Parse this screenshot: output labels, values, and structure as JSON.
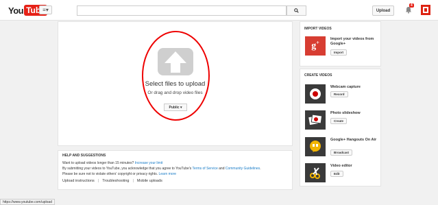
{
  "header": {
    "logo_you": "You",
    "logo_tube": "Tube",
    "guide_label": "≡▾",
    "search_placeholder": "",
    "upload_label": "Upload",
    "notification_count": "4"
  },
  "upload": {
    "title": "Select files to upload",
    "subtitle": "Or drag and drop video files",
    "privacy": "Public ▾"
  },
  "help": {
    "title": "HELP AND SUGGESTIONS",
    "line1_prefix": "Want to upload videos longer than 15 minutes? ",
    "line1_link": "Increase your limit",
    "line2_prefix": "By submitting your videos to YouTube, you acknowledge that you agree to YouTube's ",
    "line2_tos": "Terms of Service",
    "line2_and": " and ",
    "line2_guidelines": "Community Guidelines",
    "line2_end": ".",
    "line3_prefix": "Please be sure not to violate others' copyright or privacy rights. ",
    "line3_link": "Learn more",
    "links": [
      "Upload instructions",
      "Troubleshooting",
      "Mobile uploads"
    ],
    "separator": "|"
  },
  "import": {
    "title": "IMPORT VIDEOS",
    "item_title": "Import your videos from Google+",
    "button": "Import"
  },
  "create": {
    "title": "CREATE VIDEOS",
    "items": [
      {
        "title": "Webcam capture",
        "button": "Record"
      },
      {
        "title": "Photo slideshow",
        "button": "Create"
      },
      {
        "title": "Google+ Hangouts On Air",
        "button": "Broadcast"
      },
      {
        "title": "Video editor",
        "button": "Edit"
      }
    ]
  },
  "status_url": "https://www.youtube.com/upload"
}
